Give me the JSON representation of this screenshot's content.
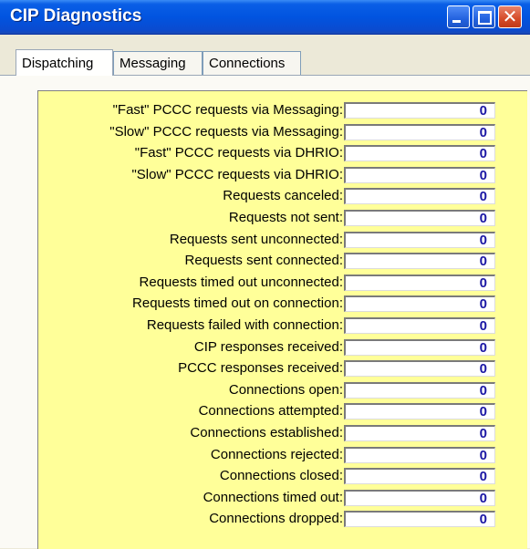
{
  "window": {
    "title": "CIP Diagnostics"
  },
  "titlebar": {
    "close_glyph": "✕"
  },
  "tabs": [
    {
      "label": "Dispatching",
      "active": true
    },
    {
      "label": "Messaging",
      "active": false
    },
    {
      "label": "Connections",
      "active": false
    }
  ],
  "rows": [
    {
      "label": "\"Fast\" PCCC requests via Messaging:",
      "value": "0"
    },
    {
      "label": "\"Slow\" PCCC requests via Messaging:",
      "value": "0"
    },
    {
      "label": "\"Fast\" PCCC requests via DHRIO:",
      "value": "0"
    },
    {
      "label": "\"Slow\" PCCC requests via DHRIO:",
      "value": "0"
    },
    {
      "label": "Requests canceled:",
      "value": "0"
    },
    {
      "label": "Requests not sent:",
      "value": "0"
    },
    {
      "label": "Requests sent unconnected:",
      "value": "0"
    },
    {
      "label": "Requests sent connected:",
      "value": "0"
    },
    {
      "label": "Requests timed out unconnected:",
      "value": "0"
    },
    {
      "label": "Requests timed out on connection:",
      "value": "0"
    },
    {
      "label": "Requests failed with connection:",
      "value": "0"
    },
    {
      "label": "CIP responses received:",
      "value": "0"
    },
    {
      "label": "PCCC responses received:",
      "value": "0"
    },
    {
      "label": "Connections open:",
      "value": "0"
    },
    {
      "label": "Connections attempted:",
      "value": "0"
    },
    {
      "label": "Connections established:",
      "value": "0"
    },
    {
      "label": "Connections rejected:",
      "value": "0"
    },
    {
      "label": "Connections closed:",
      "value": "0"
    },
    {
      "label": "Connections timed out:",
      "value": "0"
    },
    {
      "label": "Connections dropped:",
      "value": "0"
    }
  ],
  "colors": {
    "panel_fill": "#ffff99",
    "value_text": "#1b17a4",
    "titlebar": "#0154e0"
  }
}
